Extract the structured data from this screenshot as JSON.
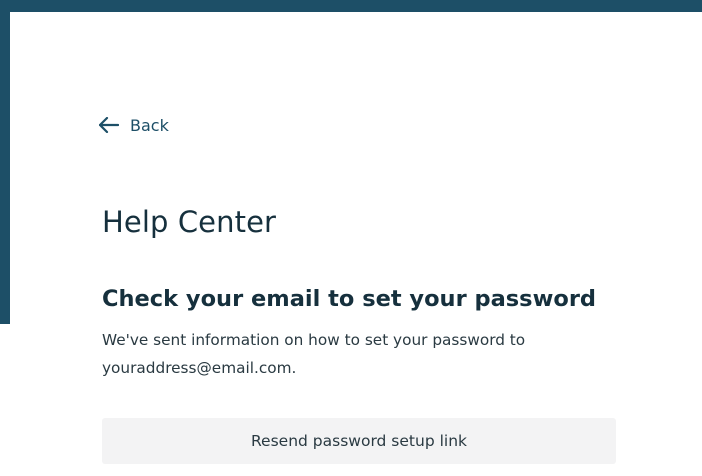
{
  "nav": {
    "back_icon": "arrow-left-icon",
    "back_label": "Back"
  },
  "page": {
    "title": "Help Center"
  },
  "confirmation": {
    "heading": "Check your email to set your password",
    "message_line1": "We've sent information on how to set your password to",
    "message_line2": "youraddress@email.com."
  },
  "actions": {
    "resend_label": "Resend password setup link"
  },
  "colors": {
    "brand_dark": "#1d4f67",
    "heading_text": "#16303d",
    "body_text": "#2a3a42",
    "button_bg": "#f3f3f4"
  }
}
